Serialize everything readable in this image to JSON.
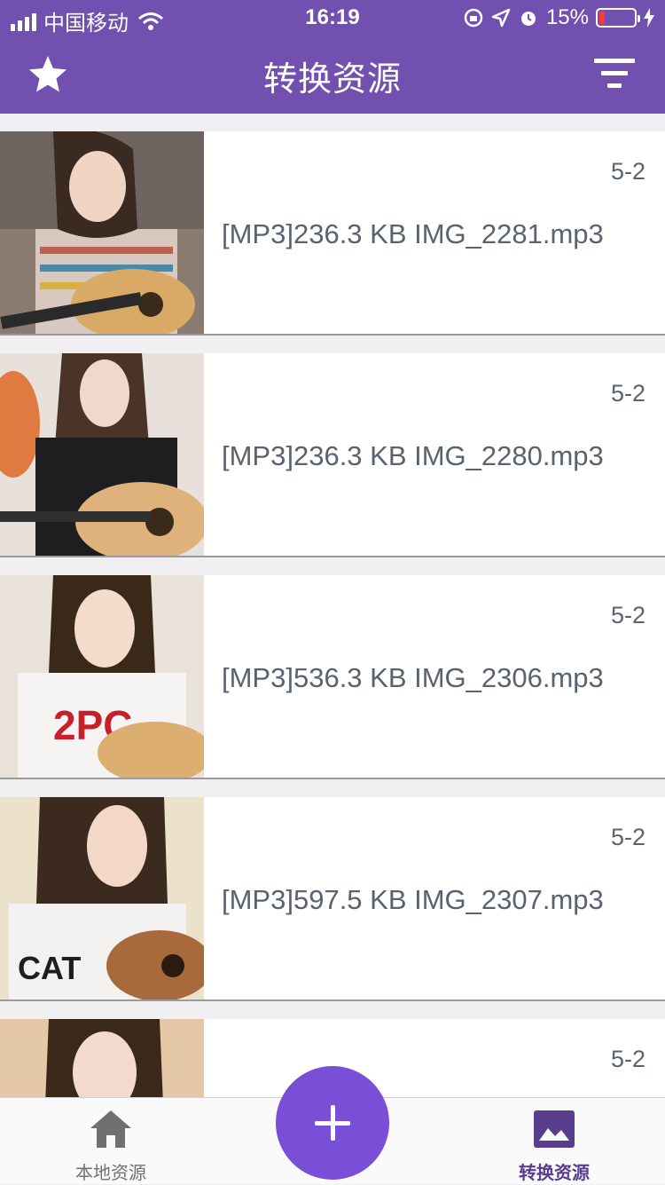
{
  "status_bar": {
    "carrier": "中国移动",
    "time": "16:19",
    "battery_percent": "15%",
    "battery_level": 0.15
  },
  "navbar": {
    "title": "转换资源",
    "left_icon": "star-icon",
    "right_icon": "filter-icon"
  },
  "items": [
    {
      "date": "5-2",
      "name": "[MP3]236.3 KB IMG_2281.mp3"
    },
    {
      "date": "5-2",
      "name": "[MP3]236.3 KB IMG_2280.mp3"
    },
    {
      "date": "5-2",
      "name": "[MP3]536.3 KB IMG_2306.mp3"
    },
    {
      "date": "5-2",
      "name": "[MP3]597.5 KB IMG_2307.mp3"
    },
    {
      "date": "5-2",
      "name": ""
    }
  ],
  "tabbar": {
    "local_label": "本地资源",
    "convert_label": "转换资源",
    "fab_icon": "plus-icon"
  },
  "colors": {
    "header": "#7150b0",
    "fab": "#7a4fd8",
    "active_tab": "#5a3d8f",
    "text_gray": "#5a6270"
  }
}
